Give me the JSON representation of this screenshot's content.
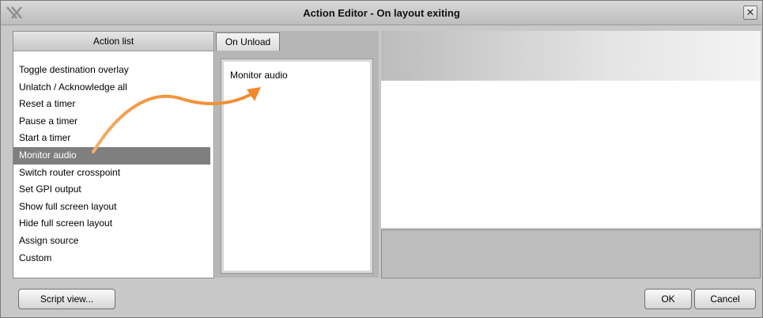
{
  "window": {
    "title": "Action Editor - On layout exiting",
    "close_glyph": "✕"
  },
  "left_panel": {
    "header": "Action list",
    "items": [
      "Toggle destination overlay",
      "Unlatch / Acknowledge all",
      "Reset a timer",
      "Pause a timer",
      "Start a timer",
      "Monitor audio",
      "Switch router crosspoint",
      "Set GPI output",
      "Show full screen layout",
      "Hide full screen layout",
      "Assign source",
      "Custom"
    ],
    "selected": "Monitor audio"
  },
  "middle_panel": {
    "tab_label": "On Unload",
    "items": [
      "Monitor audio"
    ]
  },
  "buttons": {
    "script_view": "Script view...",
    "ok": "OK",
    "cancel": "Cancel"
  },
  "icons": {
    "logo": "app-logo-icon",
    "close": "close-icon",
    "drag_arrow": "drag-arrow-icon"
  },
  "colors": {
    "selection_bg": "#7f7f7f",
    "arrow": "#f39a45"
  }
}
